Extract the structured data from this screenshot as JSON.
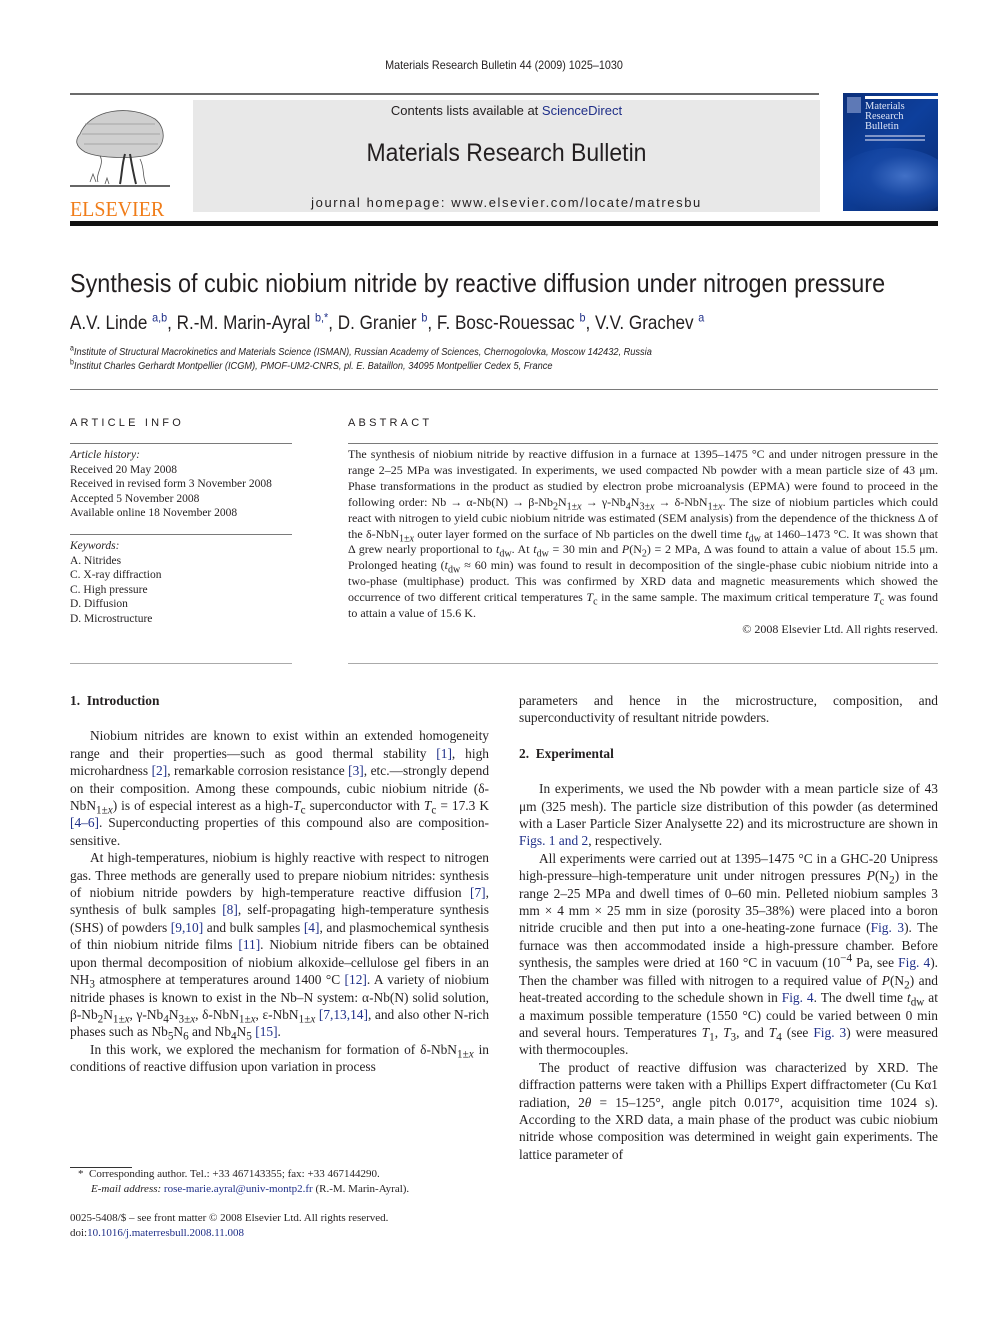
{
  "running_head": "Materials Research Bulletin 44 (2009) 1025–1030",
  "masthead": {
    "publisher": "ELSEVIER",
    "contents_prefix": "Contents lists available at ",
    "contents_link": "ScienceDirect",
    "journal_title": "Materials Research Bulletin",
    "homepage": "journal homepage: www.elsevier.com/locate/matresbu",
    "cover_title_lines": [
      "Materials",
      "Research",
      "Bulletin"
    ],
    "brand_color": "#f07d1a",
    "link_color": "#1f2f88"
  },
  "article": {
    "title": "Synthesis of cubic niobium nitride by reactive diffusion under nitrogen pressure",
    "authors": [
      {
        "name": "A.V. Linde",
        "sup": "a,b",
        "sep": ", "
      },
      {
        "name": "R.-M. Marin-Ayral",
        "sup": "b,*",
        "sep": ", "
      },
      {
        "name": "D. Granier",
        "sup": "b",
        "sep": ", "
      },
      {
        "name": "F. Bosc-Rouessac",
        "sup": "b",
        "sep": ", "
      },
      {
        "name": "V.V. Grachev",
        "sup": "a",
        "sep": ""
      }
    ],
    "affiliations": [
      {
        "mark": "a",
        "text": "Institute of Structural Macrokinetics and Materials Science (ISMAN), Russian Academy of Sciences, Chernogolovka, Moscow 142432, Russia"
      },
      {
        "mark": "b",
        "text": "Institut Charles Gerhardt Montpellier (ICGM), PMOF-UM2-CNRS, pl. E. Bataillon, 34095 Montpellier Cedex 5, France"
      }
    ]
  },
  "article_info": {
    "heading": "ARTICLE INFO",
    "history_label": "Article history:",
    "history": [
      "Received 20 May 2008",
      "Received in revised form 3 November 2008",
      "Accepted 5 November 2008",
      "Available online 18 November 2008"
    ],
    "keywords_label": "Keywords:",
    "keywords": [
      "A. Nitrides",
      "C. X-ray diffraction",
      "C. High pressure",
      "D. Diffusion",
      "D. Microstructure"
    ]
  },
  "abstract": {
    "heading": "ABSTRACT",
    "copyright": "© 2008 Elsevier Ltd. All rights reserved."
  },
  "sections": {
    "intro_heading": "1.  Introduction",
    "exp_heading": "2.  Experimental"
  },
  "footnotes": {
    "corresponding": "Corresponding author. Tel.: +33 467143355; fax: +33 467144290.",
    "email_label": "E-mail address:",
    "email": "rose-marie.ayral@univ-montp2.fr",
    "email_suffix": " (R.-M. Marin-Ayral).",
    "front_matter": "0025-5408/$ – see front matter © 2008 Elsevier Ltd. All rights reserved.",
    "doi_prefix": "doi:",
    "doi": "10.1016/j.materresbull.2008.11.008"
  }
}
